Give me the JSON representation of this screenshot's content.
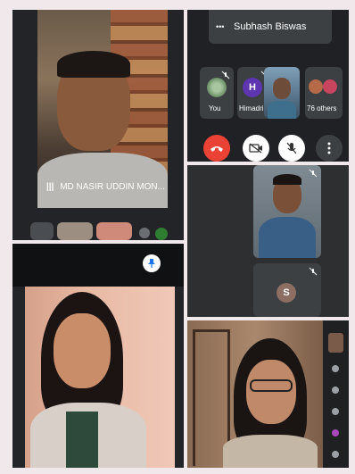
{
  "panel1": {
    "speaker_name": "MD NASIR UDDIN MON...",
    "menu_glyph": "|||"
  },
  "panel2": {
    "presenter": "Subhash Biswas",
    "menu_glyph": "•••",
    "participants": [
      {
        "label": "You"
      },
      {
        "label": "Himadri",
        "initial": "H",
        "color": "#5e35b1"
      },
      {
        "label": ""
      },
      {
        "label": "76 others"
      }
    ]
  },
  "panel4": {
    "avatar_initial": "S",
    "avatar_color": "#8d6e63"
  },
  "colors": {
    "meet_dark": "#202124",
    "end_call_red": "#ea4335",
    "pin_blue": "#1a73e8"
  }
}
